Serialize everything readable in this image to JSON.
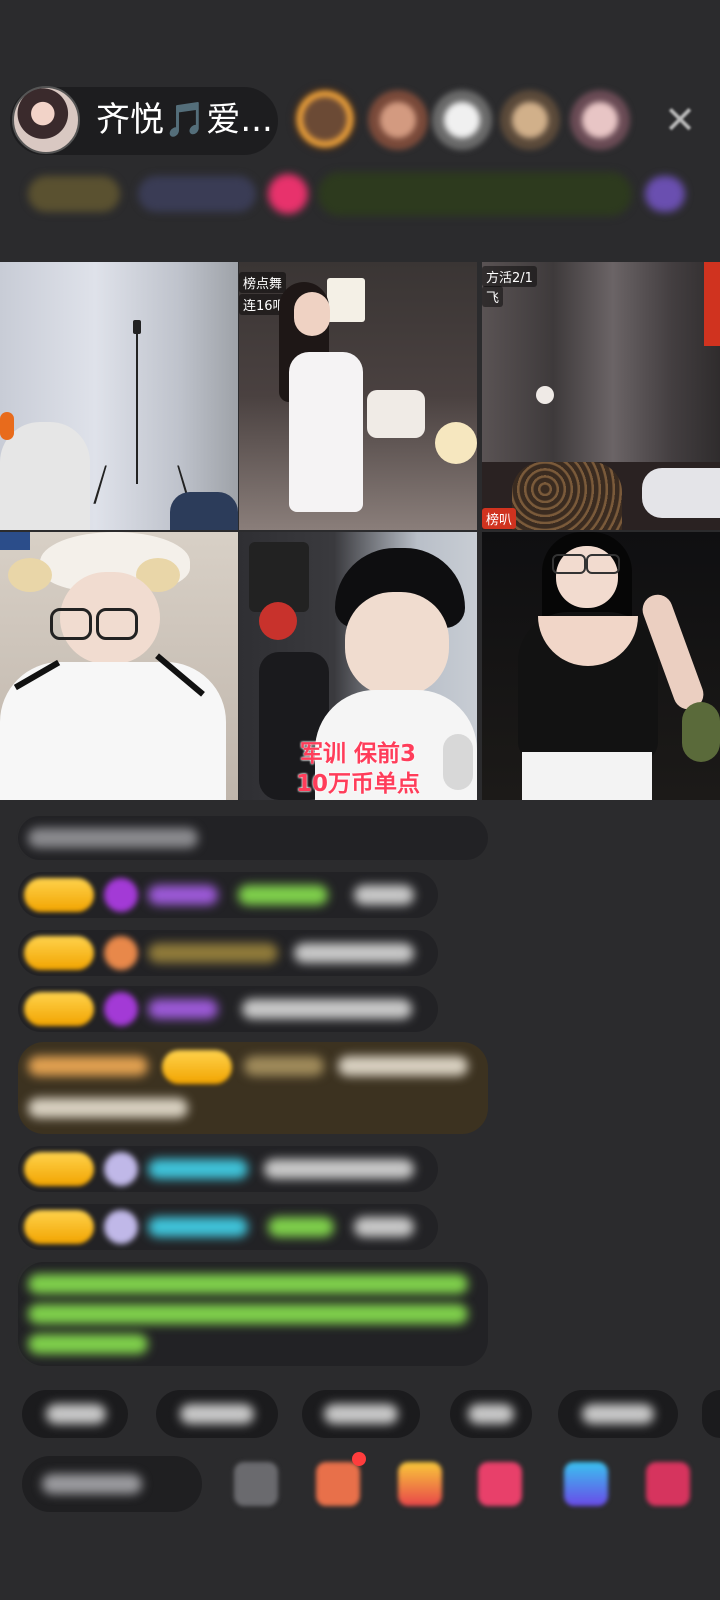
{
  "host": {
    "name": "齐悦🎵爱..."
  },
  "top_bar": {
    "close_icon": "close-icon"
  },
  "video_grid": {
    "tiles": [
      {
        "tag": ""
      },
      {
        "tag": "榜点舞\n连16吧"
      },
      {
        "tag": "方活2/1\n飞"
      },
      {
        "tag": ""
      },
      {
        "tag": "",
        "overlay_line1": "军训 保前3",
        "overlay_line2": "10万币单点"
      },
      {
        "tag": ""
      }
    ],
    "tile2_tag_line1": "榜点舞",
    "tile2_tag_line2": "连16吧",
    "tile3_tag_line1": "方活2/1",
    "tile3_tag_line2": "飞",
    "tile3_badge": "榜叭",
    "tile5_overlay_line1": "军训 保前3",
    "tile5_overlay_line2": "10万币单点"
  },
  "colors": {
    "background": "#2b2b2d",
    "accent_red": "#ff3d5a",
    "level_badge": "#f2a400",
    "chat_green": "#7fd04b",
    "chat_cyan": "#3fc3d9",
    "chat_purple": "#9b59d6"
  }
}
